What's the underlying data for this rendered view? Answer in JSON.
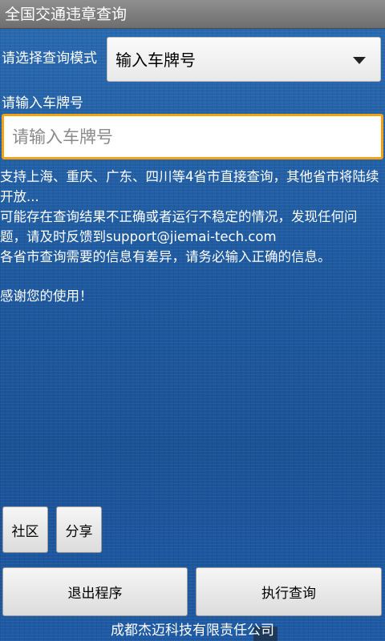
{
  "app": {
    "title": "全国交通违章查询"
  },
  "form": {
    "mode_label": "请选择查询模式",
    "mode_selected": "输入车牌号",
    "plate_label": "请输入车牌号",
    "plate_placeholder": "请输入车牌号",
    "plate_value": ""
  },
  "info": {
    "line1": "支持上海、重庆、广东、四川等4省市直接查询，其他省市将陆续开放...",
    "line2": "可能存在查询结果不正确或者运行不稳定的情况，发现任何问题，请及时反馈到support@jiemai-tech.com",
    "line3": "各省市查询需要的信息有差异，请务必输入正确的信息。",
    "line4": "感谢您的使用！"
  },
  "buttons": {
    "community": "社区",
    "share": "分享",
    "exit": "退出程序",
    "query": "执行查询"
  },
  "footer": {
    "company": "成都杰迈科技有限责任公司"
  },
  "colors": {
    "background": "#1f5ea6",
    "titlebar": "#7a7a7a",
    "input_focus_border": "#f3a214"
  }
}
